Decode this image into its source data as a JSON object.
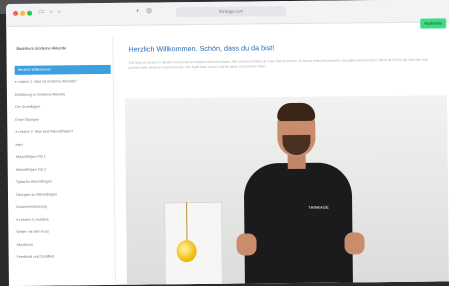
{
  "browser": {
    "url": "thinkage.com",
    "cta_label": "Kostenlos"
  },
  "sidebar": {
    "title": "Basiskurs moderne Akkorde",
    "items": [
      {
        "label": "Herzlich Willkommen",
        "active": true
      },
      {
        "label": "Lektion 1: Was ist moderne Akkorde?",
        "caret": true
      },
      {
        "label": "Einführung in moderne Akkorde",
        "caret": false
      },
      {
        "label": "Die Grundlagen",
        "caret": false
      },
      {
        "label": "Erste Übungen",
        "caret": false
      },
      {
        "label": "Lektion 2: Was sind Akkordfolgen?",
        "caret": true
      },
      {
        "label": "Intro",
        "caret": false
      },
      {
        "label": "Akkordfolgen Teil 1",
        "caret": false
      },
      {
        "label": "Akkordfolgen Teil 2",
        "caret": false
      },
      {
        "label": "Typische Akkordfolgen",
        "caret": false
      },
      {
        "label": "Übungen zu Akkordfolgen",
        "caret": false
      },
      {
        "label": "Zusammenfassung",
        "caret": false
      },
      {
        "label": "Lektion 3: Ausblick",
        "caret": true
      },
      {
        "label": "Weiter mit dem Kurs",
        "caret": false
      },
      {
        "label": "Abschluss",
        "caret": false
      },
      {
        "label": "Feedback und Zertifikat",
        "caret": false
      }
    ]
  },
  "main": {
    "heading": "Herzlich Willkommen. Schön, dass du da bist!",
    "paragraph": "Toll, dass du da bist. In diesem Kurs lernst du moderne Akkorde kennen. Alle Lektionen findest du in der Übersicht links, du kannst jederzeit pausieren und später weitermachen. Nimm dir Zeit für die Übungen und probiere alles direkt am Instrument aus. Viel Spaß beim Lernen und bis gleich im nächsten Video."
  },
  "video": {
    "shirt_logo": "THINKAGE"
  },
  "colors": {
    "accent": "#3b9fe0",
    "heading": "#2a6bb5",
    "cta": "#3ddc84"
  }
}
